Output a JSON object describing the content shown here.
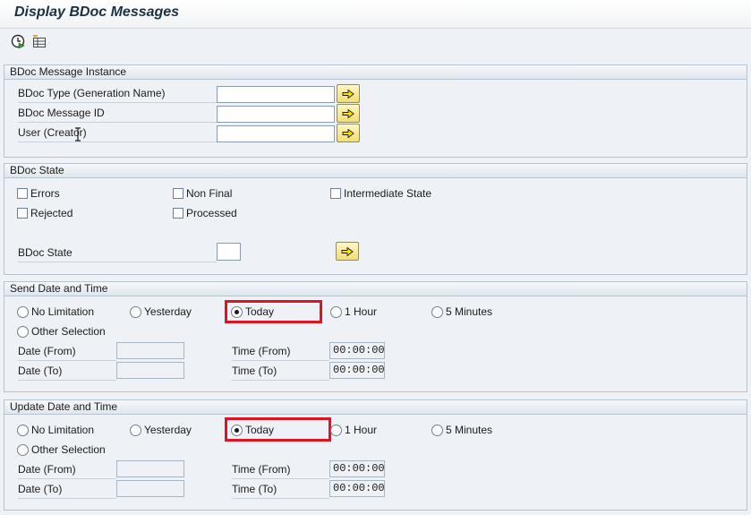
{
  "title": "Display BDoc Messages",
  "toolbar": {
    "execute_icon": "execute-clock-icon",
    "multiple_selection_icon": "multiple-selection-icon"
  },
  "instance": {
    "header": "BDoc Message Instance",
    "type_label": "BDoc Type (Generation Name)",
    "type_value": "",
    "id_label": "BDoc Message ID",
    "id_value": "",
    "user_label": "User (Creator)",
    "user_value": ""
  },
  "state": {
    "header": "BDoc State",
    "errors": "Errors",
    "non_final": "Non Final",
    "intermediate": "Intermediate State",
    "rejected": "Rejected",
    "processed": "Processed",
    "state_label": "BDoc State",
    "state_value": ""
  },
  "send": {
    "header": "Send Date and Time",
    "no_limitation": "No Limitation",
    "yesterday": "Yesterday",
    "today": "Today",
    "one_hour": "1 Hour",
    "five_minutes": "5 Minutes",
    "other_selection": "Other Selection",
    "selected": "Today",
    "date_from_label": "Date (From)",
    "date_to_label": "Date (To)",
    "time_from_label": "Time (From)",
    "time_to_label": "Time (To)",
    "time_from_value": "00:00:00",
    "time_to_value": "00:00:00"
  },
  "update": {
    "header": "Update Date and Time",
    "no_limitation": "No Limitation",
    "yesterday": "Yesterday",
    "today": "Today",
    "one_hour": "1 Hour",
    "five_minutes": "5 Minutes",
    "other_selection": "Other Selection",
    "selected": "Today",
    "date_from_label": "Date (From)",
    "date_to_label": "Date (To)",
    "time_from_label": "Time (From)",
    "time_to_label": "Time (To)",
    "time_from_value": "00:00:00",
    "time_to_value": "00:00:00"
  },
  "colors": {
    "highlight": "#e0141e",
    "arrow_button": "#f3de6e"
  }
}
